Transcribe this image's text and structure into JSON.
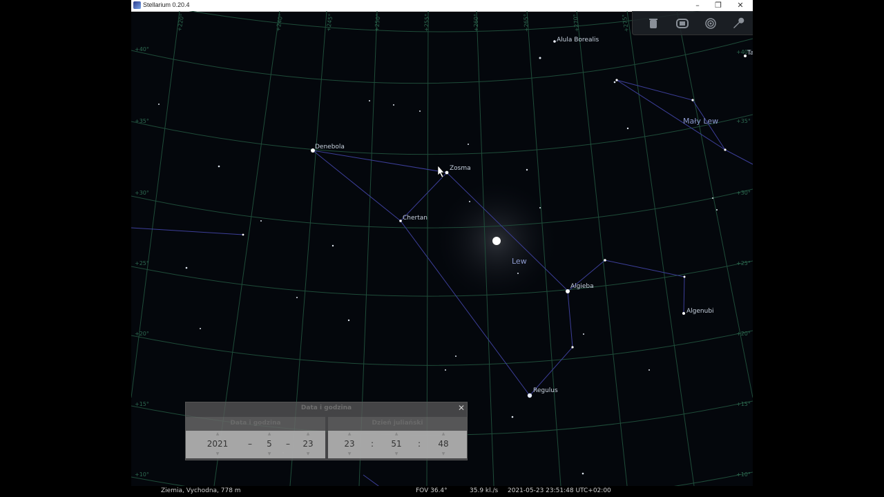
{
  "window": {
    "title": "Stellarium 0.20.4",
    "minimize": "–",
    "restore": "❐",
    "close": "✕"
  },
  "toolbar": {
    "icons": [
      "trash-icon",
      "screen-icon",
      "target-icon",
      "wrench-icon"
    ]
  },
  "sky": {
    "stars": [
      {
        "name": "Alula Borealis"
      },
      {
        "name": "Denebola"
      },
      {
        "name": "Zosma"
      },
      {
        "name": "Chertan"
      },
      {
        "name": "Algieba"
      },
      {
        "name": "Algenubi"
      },
      {
        "name": "Regulus"
      },
      {
        "name": "Ta"
      }
    ],
    "constellations": [
      "Mały Lew",
      "Lew"
    ],
    "dec_labels": [
      "+40°",
      "+35°",
      "+30°",
      "+25°",
      "+20°",
      "+15°",
      "+10°"
    ],
    "ra_labels": [
      "+220°",
      "+240°",
      "+245°",
      "+250°",
      "+255°",
      "+260°",
      "+265°",
      "+270°",
      "+275°"
    ]
  },
  "dialog": {
    "title": "Data i godzina",
    "close": "✕",
    "date_panel_title": "Data i godzina",
    "julian_panel_title": "Dzień juliański",
    "year": "2021",
    "month": "5",
    "day": "23",
    "hour": "23",
    "minute": "51",
    "second": "48",
    "date_sep": "–",
    "time_sep": ":"
  },
  "status": {
    "location": "Ziemia, Vychodna, 778 m",
    "fov": "FOV 36.4°",
    "fps": "35.9 kl./s",
    "datetime": "2021-05-23 23:51:48 UTC+02:00"
  }
}
